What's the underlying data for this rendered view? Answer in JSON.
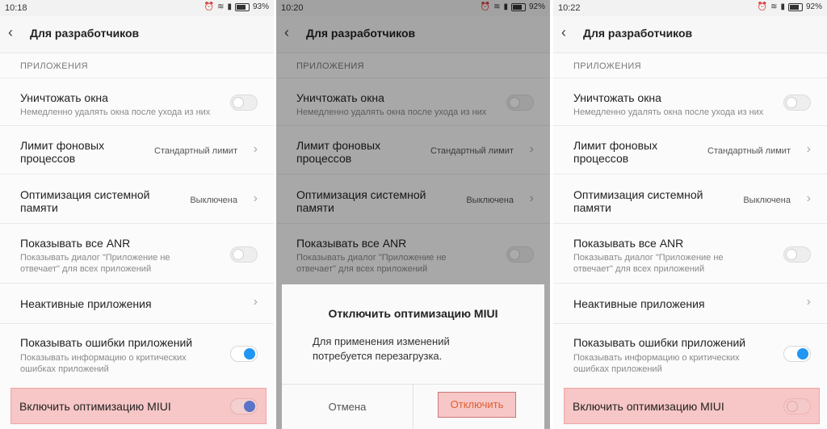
{
  "panels": [
    {
      "status": {
        "time": "10:18",
        "battery": "93%"
      },
      "header": {
        "back": "‹",
        "title": "Для разработчиков"
      },
      "section": "ПРИЛОЖЕНИЯ",
      "items": [
        {
          "title": "Уничтожать окна",
          "desc": "Немедленно удалять окна после ухода из них"
        },
        {
          "title1": "Лимит фоновых",
          "title2": "процессов",
          "value": "Стандартный лимит"
        },
        {
          "title1": "Оптимизация системной",
          "title2": "памяти",
          "value": "Выключена"
        },
        {
          "title": "Показывать все ANR",
          "desc1": "Показывать диалог \"Приложение не",
          "desc2": "отвечает\" для всех приложений"
        },
        {
          "title": "Неактивные приложения"
        },
        {
          "title": "Показывать ошибки приложений",
          "desc1": "Показывать информацию о критических",
          "desc2": "ошибках приложений"
        }
      ],
      "miui": "Включить оптимизацию MIUI"
    },
    {
      "status": {
        "time": "10:20",
        "battery": "92%"
      },
      "header": {
        "back": "‹",
        "title": "Для разработчиков"
      },
      "section": "ПРИЛОЖЕНИЯ",
      "items": [
        {
          "title": "Уничтожать окна",
          "desc": "Немедленно удалять окна после ухода из них"
        },
        {
          "title1": "Лимит фоновых",
          "title2": "процессов",
          "value": "Стандартный лимит"
        },
        {
          "title1": "Оптимизация системной",
          "title2": "памяти",
          "value": "Выключена"
        },
        {
          "title": "Показывать все ANR",
          "desc1": "Показывать диалог \"Приложение не",
          "desc2": "отвечает\" для всех приложений"
        }
      ],
      "dialog": {
        "title": "Отключить оптимизацию MIUI",
        "msg1": "Для применения изменений",
        "msg2": "потребуется перезагрузка.",
        "cancel": "Отмена",
        "ok": "Отключить"
      }
    },
    {
      "status": {
        "time": "10:22",
        "battery": "92%"
      },
      "header": {
        "back": "‹",
        "title": "Для разработчиков"
      },
      "section": "ПРИЛОЖЕНИЯ",
      "items": [
        {
          "title": "Уничтожать окна",
          "desc": "Немедленно удалять окна после ухода из них"
        },
        {
          "title1": "Лимит фоновых",
          "title2": "процессов",
          "value": "Стандартный лимит"
        },
        {
          "title1": "Оптимизация системной",
          "title2": "памяти",
          "value": "Выключена"
        },
        {
          "title": "Показывать все ANR",
          "desc1": "Показывать диалог \"Приложение не",
          "desc2": "отвечает\" для всех приложений"
        },
        {
          "title": "Неактивные приложения"
        },
        {
          "title": "Показывать ошибки приложений",
          "desc1": "Показывать информацию о критических",
          "desc2": "ошибках приложений"
        }
      ],
      "miui": "Включить оптимизацию MIUI"
    }
  ],
  "colors": {
    "toggle_on": "#2196f3",
    "highlight": "#f7c6c6",
    "ok_text": "#e0602f"
  },
  "icons": [
    "back-arrow-icon",
    "chevron-right-icon",
    "wifi-icon",
    "signal-icon",
    "battery-icon",
    "alarm-icon"
  ]
}
